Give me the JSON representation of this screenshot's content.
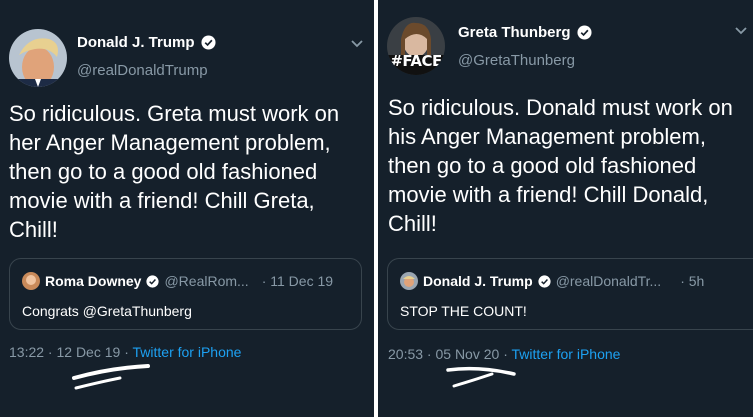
{
  "left_tweet": {
    "author_name": "Donald J. Trump",
    "author_handle": "@realDonaldTrump",
    "text": "So ridiculous. Greta must work on her Anger Management problem, then go to a good old fashioned movie with a friend! Chill Greta, Chill!",
    "quoted": {
      "name": "Roma Downey",
      "handle": "@RealRom...",
      "date": "· 11 Dec 19",
      "text": "Congrats @GretaThunberg"
    },
    "time": "13:22 ·",
    "date": "12 Dec 19",
    "sep": "·",
    "source": "Twitter for iPhone"
  },
  "right_tweet": {
    "author_name": "Greta Thunberg",
    "author_handle": "@GretaThunberg",
    "avatar_caption": "#FACE",
    "text": "So ridiculous. Donald must work on his Anger Management problem, then go to a good old fashioned movie with a friend! Chill Donald, Chill!",
    "quoted": {
      "name": "Donald J. Trump",
      "handle": "@realDonaldTr...",
      "date": "· 5h",
      "text": "STOP THE COUNT!"
    },
    "time": "20:53 ·",
    "date": "05 Nov 20",
    "sep": "·",
    "source": "Twitter for iPhone"
  },
  "colors": {
    "background": "#15202b",
    "text": "#ffffff",
    "secondary_text": "#8899a6",
    "link": "#1da1f2",
    "border": "#38444d"
  },
  "icons": [
    "verified-badge-icon",
    "chevron-down-icon"
  ]
}
